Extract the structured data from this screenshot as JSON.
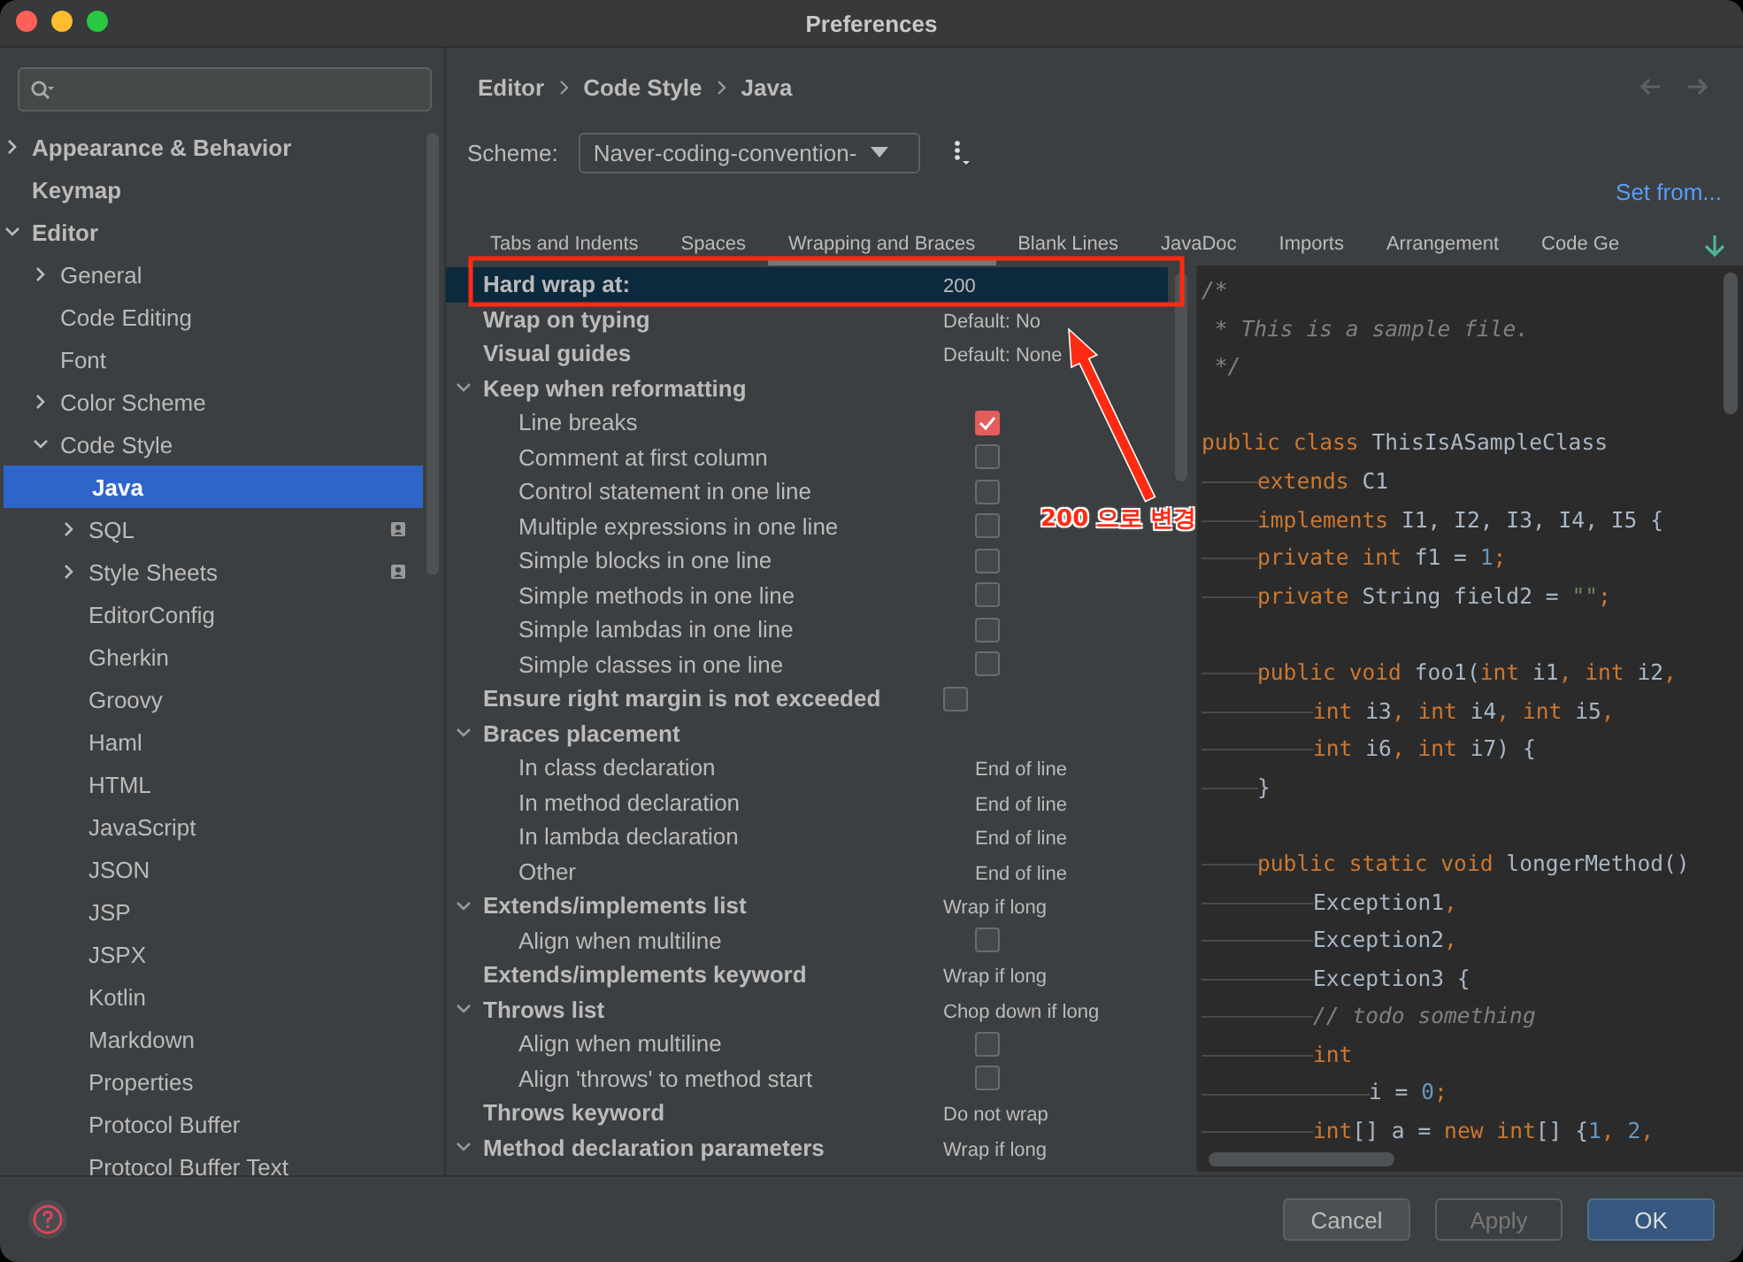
{
  "window": {
    "title": "Preferences"
  },
  "sidebar": {
    "items": [
      {
        "label": "Appearance & Behavior",
        "expanded": false,
        "selected": false
      },
      {
        "label": "Keymap",
        "selected": false
      },
      {
        "label": "Editor",
        "expanded": true,
        "selected": false,
        "children": [
          {
            "label": "General",
            "expanded": false,
            "selected": false
          },
          {
            "label": "Code Editing",
            "selected": false
          },
          {
            "label": "Font",
            "selected": false
          },
          {
            "label": "Color Scheme",
            "expanded": false,
            "selected": false
          },
          {
            "label": "Code Style",
            "expanded": true,
            "selected": false,
            "children": [
              {
                "label": "Java",
                "selected": true
              },
              {
                "label": "SQL",
                "expanded": false,
                "selected": false,
                "project_icon": true
              },
              {
                "label": "Style Sheets",
                "expanded": false,
                "selected": false,
                "project_icon": true
              },
              {
                "label": "EditorConfig",
                "selected": false
              },
              {
                "label": "Gherkin",
                "selected": false
              },
              {
                "label": "Groovy",
                "selected": false
              },
              {
                "label": "Haml",
                "selected": false
              },
              {
                "label": "HTML",
                "selected": false
              },
              {
                "label": "JavaScript",
                "selected": false
              },
              {
                "label": "JSON",
                "selected": false
              },
              {
                "label": "JSP",
                "selected": false
              },
              {
                "label": "JSPX",
                "selected": false
              },
              {
                "label": "Kotlin",
                "selected": false
              },
              {
                "label": "Markdown",
                "selected": false
              },
              {
                "label": "Properties",
                "selected": false
              },
              {
                "label": "Protocol Buffer",
                "selected": false
              },
              {
                "label": "Protocol Buffer Text",
                "selected": false
              }
            ]
          }
        ]
      }
    ]
  },
  "breadcrumb": [
    "Editor",
    "Code Style",
    "Java"
  ],
  "scheme": {
    "label": "Scheme:",
    "value": "Naver-coding-convention-"
  },
  "set_from": "Set from...",
  "tabs": [
    {
      "label": "Tabs and Indents",
      "selected": false
    },
    {
      "label": "Spaces",
      "selected": false
    },
    {
      "label": "Wrapping and Braces",
      "selected": true
    },
    {
      "label": "Blank Lines",
      "selected": false
    },
    {
      "label": "JavaDoc",
      "selected": false
    },
    {
      "label": "Imports",
      "selected": false
    },
    {
      "label": "Arrangement",
      "selected": false
    },
    {
      "label": "Code Ge",
      "selected": false
    }
  ],
  "settings": [
    {
      "label": "Hard wrap at:",
      "kind": "value",
      "value": "200",
      "selected": true
    },
    {
      "label": "Wrap on typing",
      "kind": "value",
      "value": "Default: No",
      "selected": false
    },
    {
      "label": "Visual guides",
      "kind": "value",
      "value": "Default: None",
      "selected": false
    },
    {
      "label": "Keep when reformatting",
      "kind": "group",
      "expanded": true,
      "selected": false,
      "children": [
        {
          "label": "Line breaks",
          "kind": "checkbox",
          "checked": true,
          "selected": false
        },
        {
          "label": "Comment at first column",
          "kind": "checkbox",
          "checked": false,
          "selected": false
        },
        {
          "label": "Control statement in one line",
          "kind": "checkbox",
          "checked": false,
          "selected": false
        },
        {
          "label": "Multiple expressions in one line",
          "kind": "checkbox",
          "checked": false,
          "selected": false
        },
        {
          "label": "Simple blocks in one line",
          "kind": "checkbox",
          "checked": false,
          "selected": false
        },
        {
          "label": "Simple methods in one line",
          "kind": "checkbox",
          "checked": false,
          "selected": false
        },
        {
          "label": "Simple lambdas in one line",
          "kind": "checkbox",
          "checked": false,
          "selected": false
        },
        {
          "label": "Simple classes in one line",
          "kind": "checkbox",
          "checked": false,
          "selected": false
        }
      ]
    },
    {
      "label": "Ensure right margin is not exceeded",
      "kind": "checkbox",
      "checked": false,
      "selected": false
    },
    {
      "label": "Braces placement",
      "kind": "group",
      "expanded": true,
      "selected": false,
      "children": [
        {
          "label": "In class declaration",
          "kind": "value",
          "value": "End of line",
          "selected": false
        },
        {
          "label": "In method declaration",
          "kind": "value",
          "value": "End of line",
          "selected": false
        },
        {
          "label": "In lambda declaration",
          "kind": "value",
          "value": "End of line",
          "selected": false
        },
        {
          "label": "Other",
          "kind": "value",
          "value": "End of line",
          "selected": false
        }
      ]
    },
    {
      "label": "Extends/implements list",
      "kind": "value",
      "value": "Wrap if long",
      "expanded": true,
      "selected": false,
      "children": [
        {
          "label": "Align when multiline",
          "kind": "checkbox",
          "checked": false,
          "selected": false
        }
      ]
    },
    {
      "label": "Extends/implements keyword",
      "kind": "value",
      "value": "Wrap if long",
      "selected": false
    },
    {
      "label": "Throws list",
      "kind": "value",
      "value": "Chop down if long",
      "expanded": true,
      "selected": false,
      "children": [
        {
          "label": "Align when multiline",
          "kind": "checkbox",
          "checked": false,
          "selected": false
        },
        {
          "label": "Align 'throws' to method start",
          "kind": "checkbox",
          "checked": false,
          "selected": false
        }
      ]
    },
    {
      "label": "Throws keyword",
      "kind": "value",
      "value": "Do not wrap",
      "selected": false
    },
    {
      "label": "Method declaration parameters",
      "kind": "value",
      "value": "Wrap if long",
      "expanded": true,
      "selected": false
    }
  ],
  "preview": [
    {
      "kind": "code",
      "tokens": [
        {
          "kind": "comment",
          "text": "/*"
        }
      ]
    },
    {
      "kind": "code",
      "tokens": [
        {
          "kind": "comment",
          "text": " * This is a sample file."
        }
      ]
    },
    {
      "kind": "code",
      "tokens": [
        {
          "kind": "comment",
          "text": " */"
        }
      ]
    },
    {
      "kind": "blank"
    },
    {
      "kind": "code",
      "tokens": [
        {
          "kind": "keyword",
          "text": "public class "
        },
        {
          "kind": "plain",
          "text": "ThisIsASampleClass"
        }
      ]
    },
    {
      "kind": "code",
      "tokens": [
        {
          "kind": "tab"
        },
        {
          "kind": "keyword",
          "text": "extends "
        },
        {
          "kind": "plain",
          "text": "C1"
        }
      ]
    },
    {
      "kind": "code",
      "tokens": [
        {
          "kind": "tab"
        },
        {
          "kind": "keyword",
          "text": "implements "
        },
        {
          "kind": "plain",
          "text": "I1, I2, I3, I4, I5 {"
        }
      ]
    },
    {
      "kind": "code",
      "tokens": [
        {
          "kind": "tab"
        },
        {
          "kind": "keyword",
          "text": "private int "
        },
        {
          "kind": "plain",
          "text": "f1 = "
        },
        {
          "kind": "number",
          "text": "1"
        },
        {
          "kind": "keyword",
          "text": ";"
        }
      ]
    },
    {
      "kind": "code",
      "tokens": [
        {
          "kind": "tab"
        },
        {
          "kind": "keyword",
          "text": "private "
        },
        {
          "kind": "plain",
          "text": "String field2 = "
        },
        {
          "kind": "string",
          "text": "\"\""
        },
        {
          "kind": "keyword",
          "text": ";"
        }
      ]
    },
    {
      "kind": "blank"
    },
    {
      "kind": "code",
      "tokens": [
        {
          "kind": "tab"
        },
        {
          "kind": "keyword",
          "text": "public void "
        },
        {
          "kind": "plain",
          "text": "foo1("
        },
        {
          "kind": "keyword",
          "text": "int "
        },
        {
          "kind": "plain",
          "text": "i1"
        },
        {
          "kind": "keyword",
          "text": ", int "
        },
        {
          "kind": "plain",
          "text": "i2"
        },
        {
          "kind": "keyword",
          "text": ","
        }
      ]
    },
    {
      "kind": "code",
      "tokens": [
        {
          "kind": "tab"
        },
        {
          "kind": "tab"
        },
        {
          "kind": "keyword",
          "text": "int "
        },
        {
          "kind": "plain",
          "text": "i3"
        },
        {
          "kind": "keyword",
          "text": ", int "
        },
        {
          "kind": "plain",
          "text": "i4"
        },
        {
          "kind": "keyword",
          "text": ", int "
        },
        {
          "kind": "plain",
          "text": "i5"
        },
        {
          "kind": "keyword",
          "text": ","
        }
      ]
    },
    {
      "kind": "code",
      "tokens": [
        {
          "kind": "tab"
        },
        {
          "kind": "tab"
        },
        {
          "kind": "keyword",
          "text": "int "
        },
        {
          "kind": "plain",
          "text": "i6"
        },
        {
          "kind": "keyword",
          "text": ", int "
        },
        {
          "kind": "plain",
          "text": "i7) {"
        }
      ]
    },
    {
      "kind": "code",
      "tokens": [
        {
          "kind": "tab"
        },
        {
          "kind": "plain",
          "text": "}"
        }
      ]
    },
    {
      "kind": "blank"
    },
    {
      "kind": "code",
      "tokens": [
        {
          "kind": "tab"
        },
        {
          "kind": "keyword",
          "text": "public static void "
        },
        {
          "kind": "plain",
          "text": "longerMethod()"
        }
      ]
    },
    {
      "kind": "code",
      "tokens": [
        {
          "kind": "tab"
        },
        {
          "kind": "tab"
        },
        {
          "kind": "plain",
          "text": "Exception1"
        },
        {
          "kind": "keyword",
          "text": ","
        }
      ]
    },
    {
      "kind": "code",
      "tokens": [
        {
          "kind": "tab"
        },
        {
          "kind": "tab"
        },
        {
          "kind": "plain",
          "text": "Exception2"
        },
        {
          "kind": "keyword",
          "text": ","
        }
      ]
    },
    {
      "kind": "code",
      "tokens": [
        {
          "kind": "tab"
        },
        {
          "kind": "tab"
        },
        {
          "kind": "plain",
          "text": "Exception3 {"
        }
      ]
    },
    {
      "kind": "code",
      "tokens": [
        {
          "kind": "tab"
        },
        {
          "kind": "tab"
        },
        {
          "kind": "comment",
          "text": "// todo something"
        }
      ]
    },
    {
      "kind": "code",
      "tokens": [
        {
          "kind": "tab"
        },
        {
          "kind": "tab"
        },
        {
          "kind": "keyword",
          "text": "int"
        }
      ]
    },
    {
      "kind": "code",
      "tokens": [
        {
          "kind": "tab"
        },
        {
          "kind": "tab"
        },
        {
          "kind": "tab"
        },
        {
          "kind": "plain",
          "text": "i = "
        },
        {
          "kind": "number",
          "text": "0"
        },
        {
          "kind": "keyword",
          "text": ";"
        }
      ]
    },
    {
      "kind": "code",
      "tokens": [
        {
          "kind": "tab"
        },
        {
          "kind": "tab"
        },
        {
          "kind": "keyword",
          "text": "int"
        },
        {
          "kind": "plain",
          "text": "[] a = "
        },
        {
          "kind": "keyword",
          "text": "new int"
        },
        {
          "kind": "plain",
          "text": "[] {"
        },
        {
          "kind": "number",
          "text": "1"
        },
        {
          "kind": "keyword",
          "text": ", "
        },
        {
          "kind": "number",
          "text": "2"
        },
        {
          "kind": "keyword",
          "text": ","
        }
      ]
    }
  ],
  "annotation": {
    "label": "200 으로 변경"
  },
  "buttons": [
    {
      "label": "Cancel",
      "kind": "normal",
      "disabled": false
    },
    {
      "label": "Apply",
      "kind": "normal",
      "disabled": true
    },
    {
      "label": "OK",
      "kind": "primary",
      "disabled": false
    }
  ]
}
